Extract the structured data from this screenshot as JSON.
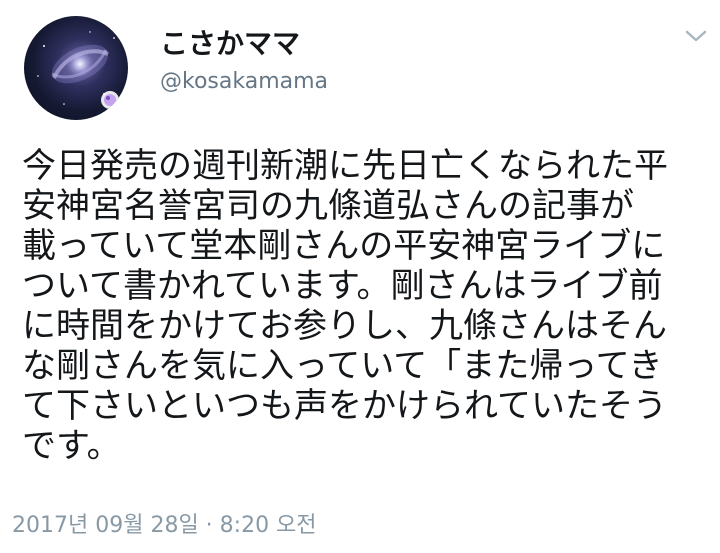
{
  "author": {
    "display_name": "こさかママ",
    "handle": "@kosakamama",
    "avatar_icon": "galaxy-avatar-icon"
  },
  "menu": {
    "icon": "chevron-down-icon"
  },
  "tweet": {
    "lines": [
      "今日発売の週刊新潮に先日亡くなられた平",
      "安神宮名誉宮司の九條道弘さんの記事が",
      "載っていて堂本剛さんの平安神宮ライブに",
      "ついて書かれています。剛さんはライブ前",
      "に時間をかけてお参りし、九條さんはそん",
      "な剛さんを気に入っていて「また帰ってき",
      "て下さいといつも声をかけられていたそう",
      "です。"
    ],
    "timestamp": "2017년 09월 28일 · 8:20 오전"
  },
  "colors": {
    "text": "#14171a",
    "secondary": "#657786",
    "timestamp": "#8899a6",
    "background": "#ffffff"
  }
}
